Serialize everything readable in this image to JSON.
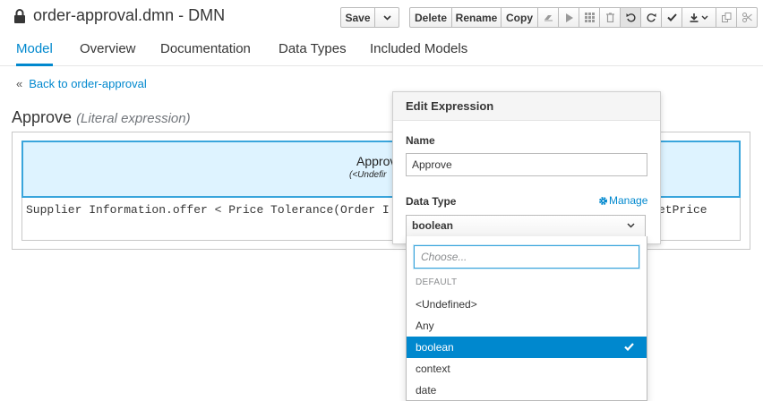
{
  "window": {
    "title": "order-approval.dmn - DMN"
  },
  "toolbar": {
    "save": "Save",
    "delete": "Delete",
    "rename": "Rename",
    "copy": "Copy"
  },
  "tabs": [
    {
      "label": "Model",
      "active": true
    },
    {
      "label": "Overview",
      "active": false
    },
    {
      "label": "Documentation",
      "active": false
    },
    {
      "label": "Data Types",
      "active": false
    },
    {
      "label": "Included Models",
      "active": false
    }
  ],
  "back_link": {
    "chevron": "«",
    "label": "Back to order-approval"
  },
  "section": {
    "title": "Approve",
    "subtitle": "(Literal expression)"
  },
  "grid": {
    "header_name": "Approv",
    "header_type": "(<Undefir",
    "expression": "Supplier Information.offer < Price Tolerance(Order I",
    "expression_tail": "etPrice"
  },
  "popover": {
    "title": "Edit Expression",
    "name_label": "Name",
    "name_value": "Approve",
    "type_label": "Data Type",
    "manage_label": "Manage",
    "selected_type": "boolean"
  },
  "dropdown": {
    "search_placeholder": "Choose...",
    "group_label": "DEFAULT",
    "items": [
      {
        "label": "<Undefined>",
        "selected": false
      },
      {
        "label": "Any",
        "selected": false
      },
      {
        "label": "boolean",
        "selected": true
      },
      {
        "label": "context",
        "selected": false
      },
      {
        "label": "date",
        "selected": false
      }
    ]
  },
  "colors": {
    "accent": "#0088ce",
    "header_bg": "#def3ff",
    "header_border": "#39a5dc"
  }
}
